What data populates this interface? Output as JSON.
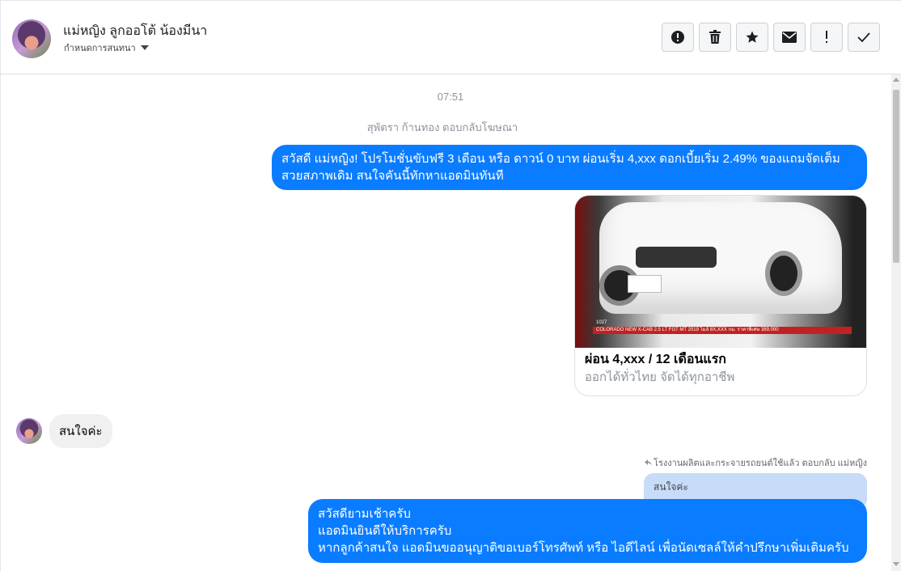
{
  "header": {
    "contact_name": "แม่หญิง ลูกออโต้ น้องมีนา",
    "assign_label": "กำหนดการสนทนา",
    "actions": [
      {
        "icon": "alert-circle-icon"
      },
      {
        "icon": "trash-icon"
      },
      {
        "icon": "star-icon"
      },
      {
        "icon": "envelope-icon"
      },
      {
        "icon": "exclamation-icon"
      },
      {
        "icon": "checkmark-icon"
      }
    ]
  },
  "conversation": {
    "timestamp": "07:51",
    "replied_to_ad": "สุพัตรา ก้านทอง ตอบกลับโฆษณา",
    "messages": {
      "outgoing_1": "สวัสดี แม่หญิง! โปรโมชั่นขับฟรี 3 เดือน หรือ ดาวน์ 0 บาท ผ่อนเริ่ม 4,xxx ดอกเบี้ยเริ่ม 2.49% ของแถมจัดเต็ม สวยสภาพเดิม สนใจคันนี้ทักหาแอดมินทันที",
      "ad_card": {
        "image_caption": "COLORADO NEW X-CAB 2.5 LT FGT MT 2019 ไมล์ 8X,XXX กม. ราคาพิเศษ 389,000",
        "image_code": "1027",
        "title": "ผ่อน 4,xxx / 12 เดือนแรก",
        "subtitle": "ออกได้ทั่วไทย จัดได้ทุกอาชีพ"
      },
      "incoming_1": "สนใจค่ะ",
      "reply_note": "โรงงานผลิตและกระจายรถยนต์ใช้แล้ว ตอบกลับ แม่หญิง",
      "quoted_text": "สนใจค่ะ",
      "outgoing_2_lines": [
        "สวัสดียามเช้าครับ",
        "แอดมินยินดีให้บริการครับ",
        "หากลูกค้าสนใจ แอดมินขออนุญาติขอเบอร์โทรศัพท์ หรือ ไอดีไลน์ เพื่อนัดเซลล์ให้คำปรึกษาเพิ่มเติมครับ"
      ]
    }
  },
  "colors": {
    "outgoing_bubble": "#0a7cff",
    "incoming_bubble": "#f0f0f0",
    "quoted_bubble": "#c7dcf9"
  }
}
